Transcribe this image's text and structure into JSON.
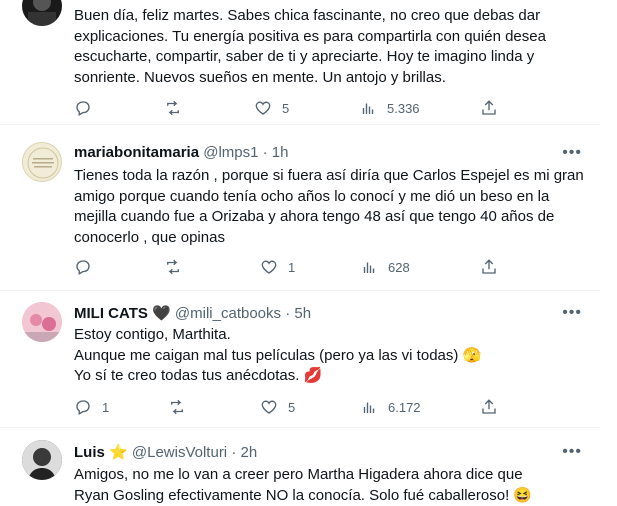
{
  "tweets": [
    {
      "name": "",
      "handle": "",
      "time": "",
      "text": "Buen día, feliz martes. Sabes chica fascinante, no creo que debas dar explicaciones. Tu energía positiva es para compartirla con quién desea escucharte, compartir, saber de ti y apreciarte. Hoy te imagino linda y sonriente. Nuevos sueños en mente. Un antojo y brillas.",
      "replies": "",
      "retweets": "",
      "likes": "5",
      "views": "5.336"
    },
    {
      "name": "mariabonitamaria",
      "handle": "@lmps1",
      "time": "· 1h",
      "text": "Tienes toda la razón , porque si fuera así diría que Carlos Espejel es mi gran amigo porque cuando tenía ocho años lo conocí y me dió un beso en la mejilla cuando fue a Orizaba y ahora tengo 48 así que tengo 40 años de conocerlo , que opinas",
      "replies": "",
      "retweets": "",
      "likes": "1",
      "views": "628"
    },
    {
      "name": "MILI CATS",
      "name_emoji": "🖤",
      "handle": "@mili_catbooks",
      "time": "· 5h",
      "text_lines": [
        "Estoy contigo, Marthita.",
        "Aunque me caigan mal tus películas (pero ya las vi todas)",
        "Yo sí te creo todas tus anécdotas."
      ],
      "line2_emoji": "🫣",
      "line3_emoji": "💋",
      "replies": "1",
      "retweets": "",
      "likes": "5",
      "views": "6.172"
    },
    {
      "name": "Luis",
      "name_emoji": "⭐",
      "handle": "@LewisVolturi",
      "time": "· 2h",
      "text": "Amigos, no me lo van a creer pero Martha Higadera ahora dice que Ryan Gosling efectivamente NO la conocía. Solo fué caballeroso!",
      "text_emoji": "😆"
    }
  ],
  "ui": {
    "more": "•••",
    "accent": "#1d9bf0",
    "muted": "#536471"
  }
}
